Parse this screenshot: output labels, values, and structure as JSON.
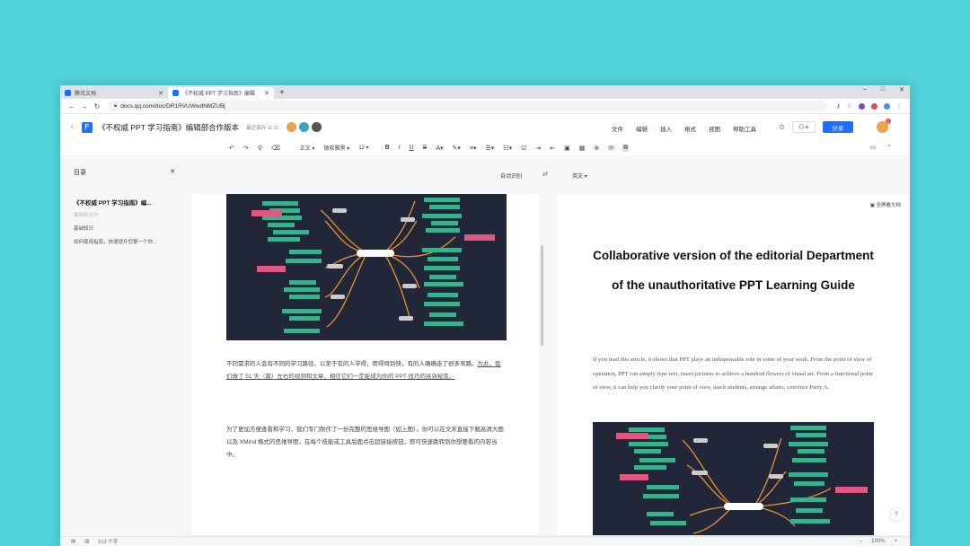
{
  "browser": {
    "tabs": [
      {
        "label": "腾讯文档",
        "active": false
      },
      {
        "label": "《不权威 PPT 学习指南》编辑",
        "active": true
      }
    ],
    "url": "docs.qq.com/doc/DR1RVUWwdNMZUBj",
    "window_controls": [
      "–",
      "□",
      "✕"
    ]
  },
  "doc": {
    "title": "《不权威 PPT 学习指南》编辑部合作版本",
    "saved_status": "最近保存 11:11",
    "menus": [
      "文件",
      "编辑",
      "插入",
      "格式",
      "视图",
      "帮助工具"
    ],
    "share_label": "分享",
    "notification_count": "1"
  },
  "toolbar": {
    "style_select": "正文",
    "font_select": "微软雅黑",
    "size_select": "12"
  },
  "sidebar": {
    "header": "目录",
    "title": "《不权威 PPT 学习指南》编...",
    "subtitle": "编辑部合作",
    "items": [
      "基础知识",
      "如何使用指南，快速提升您第一个你..."
    ]
  },
  "translation": {
    "source": "自动识别",
    "swap": "⇄",
    "target": "英文",
    "full_translate": "全屏看文档"
  },
  "left_page": {
    "para1_text": "不同需求的人会有不同的学习路径，以至于有的人学得，用得特别快，有的人确确走了很多弯路。",
    "para1_link": "为此，我们做了 51 天（篇）左右的视频和文章，相信它们一定能成为你的 PPT 技巧的高效秘笈。",
    "para2": "为了更加方便查看和学习，我们专门制作了一份完整的思维导图（如上图），你可以在文末直接下载高清大图以及 XMind 格式的思维导图，在每个技能或工具后面点击超链接按钮，即可快速跳转到你想要看的内容当中。"
  },
  "right_page": {
    "title": "Collaborative version of the editorial Department of the unauthoritative PPT Learning Guide",
    "paragraph": "If you read this article, it shows that PPT plays an indispensable role in some of your work. From the point of view of operation, PPT can simply type text, insert pictures to achieve a hundred flowers of visual art. From a functional point of view, it can help you clarify your point of view, teach students, arrange affairs, convince Party A."
  },
  "help_label": "?",
  "status": {
    "word_count": "513 个字",
    "zoom": "100%",
    "zoom_minus": "–",
    "zoom_plus": "+"
  },
  "colors": {
    "background": "#52d2da",
    "accent": "#1e6fff",
    "mindmap_bg": "#222639",
    "mindmap_branch": "#e8922c",
    "mindmap_node": "#3bb08f",
    "mindmap_highlight": "#e0577f"
  }
}
